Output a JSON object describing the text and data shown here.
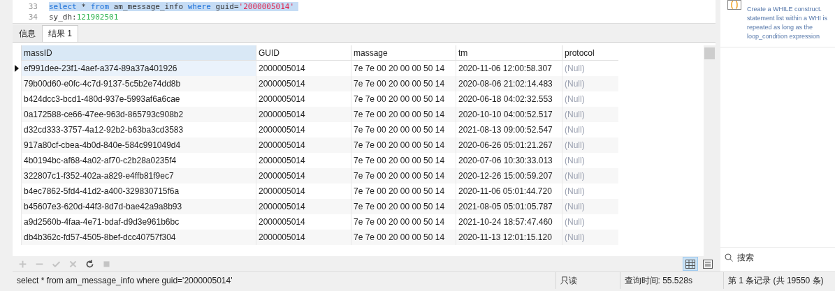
{
  "editor": {
    "lines": [
      {
        "number": "33",
        "highlighted": true,
        "tokens": [
          {
            "kind": "keyword",
            "text": "select"
          },
          {
            "kind": "plain",
            "text": " * "
          },
          {
            "kind": "keyword",
            "text": "from"
          },
          {
            "kind": "plain",
            "text": " am_message_info "
          },
          {
            "kind": "keyword",
            "text": "where"
          },
          {
            "kind": "plain",
            "text": " guid="
          },
          {
            "kind": "string",
            "text": "'2000005014'"
          }
        ]
      },
      {
        "number": "34",
        "highlighted": false,
        "tokens": [
          {
            "kind": "plain",
            "text": "sy_dh:"
          },
          {
            "kind": "number",
            "text": "121902501"
          }
        ]
      }
    ]
  },
  "help_panel": {
    "text": "Create a WHILE construct. statement list within a WHI is repeated as long as the loop_condition expression"
  },
  "tabs": [
    {
      "label": "信息",
      "selected": false
    },
    {
      "label": "结果 1",
      "selected": true
    }
  ],
  "table": {
    "columns": [
      "massID",
      "GUID",
      "massage",
      "tm",
      "protocol"
    ],
    "rows": [
      {
        "selected": true,
        "cells": [
          "ef991dee-23f1-4aef-a374-89a37a401926",
          "2000005014",
          "7e 7e 00 20 00 00 50 14",
          "2020-11-06 12:00:58.307",
          "(Null)"
        ]
      },
      {
        "selected": false,
        "cells": [
          "79b00d60-e0fc-4c7d-9137-5c5b2e74dd8b",
          "2000005014",
          "7e 7e 00 20 00 00 50 14",
          "2020-08-06 21:02:14.483",
          "(Null)"
        ]
      },
      {
        "selected": false,
        "cells": [
          "b424dcc3-bcd1-480d-937e-5993af6a6cae",
          "2000005014",
          "7e 7e 00 20 00 00 50 14",
          "2020-06-18 04:02:32.553",
          "(Null)"
        ]
      },
      {
        "selected": false,
        "cells": [
          "0a172588-ce66-47ee-963d-865793c908b2",
          "2000005014",
          "7e 7e 00 20 00 00 50 14",
          "2020-10-10 04:00:52.517",
          "(Null)"
        ]
      },
      {
        "selected": false,
        "cells": [
          "d32cd333-3757-4a12-92b2-b63ba3cd3583",
          "2000005014",
          "7e 7e 00 20 00 00 50 14",
          "2021-08-13 09:00:52.547",
          "(Null)"
        ]
      },
      {
        "selected": false,
        "cells": [
          "917a80cf-cbea-4b0d-840e-584c991049d4",
          "2000005014",
          "7e 7e 00 20 00 00 50 14",
          "2020-06-26 05:01:21.267",
          "(Null)"
        ]
      },
      {
        "selected": false,
        "cells": [
          "4b0194bc-af68-4a02-af70-c2b28a0235f4",
          "2000005014",
          "7e 7e 00 20 00 00 50 14",
          "2020-07-06 10:30:33.013",
          "(Null)"
        ]
      },
      {
        "selected": false,
        "cells": [
          "322807c1-f352-402a-a829-e4ffb81f9ec7",
          "2000005014",
          "7e 7e 00 20 00 00 50 14",
          "2020-12-26 15:00:59.207",
          "(Null)"
        ]
      },
      {
        "selected": false,
        "cells": [
          "b4ec7862-5fd4-41d2-a400-329830715f6a",
          "2000005014",
          "7e 7e 00 20 00 00 50 14",
          "2020-11-06 05:01:44.720",
          "(Null)"
        ]
      },
      {
        "selected": false,
        "cells": [
          "b45607e3-620d-44f3-8d7d-bae42a9a8b93",
          "2000005014",
          "7e 7e 00 20 00 00 50 14",
          "2021-08-05 05:01:05.787",
          "(Null)"
        ]
      },
      {
        "selected": false,
        "cells": [
          "a9d2560b-4faa-4e71-bdaf-d9d3e961b6bc",
          "2000005014",
          "7e 7e 00 20 00 00 50 14",
          "2021-10-24 18:57:47.460",
          "(Null)"
        ]
      },
      {
        "selected": false,
        "cells": [
          "db4b362c-fd57-4505-8bef-dcc40757f304",
          "2000005014",
          "7e 7e 00 20 00 00 50 14",
          "2020-11-13 12:01:15.120",
          "(Null)"
        ]
      }
    ]
  },
  "toolbar": [
    {
      "kind": "add",
      "disabled": true
    },
    {
      "kind": "remove",
      "disabled": true
    },
    {
      "kind": "apply",
      "disabled": true
    },
    {
      "kind": "cancel",
      "disabled": true
    },
    {
      "kind": "refresh",
      "disabled": false
    },
    {
      "kind": "stop",
      "disabled": true
    }
  ],
  "view_toggle": [
    {
      "kind": "grid",
      "selected": true
    },
    {
      "kind": "form",
      "selected": false
    }
  ],
  "search": {
    "placeholder": "搜索"
  },
  "status_bar": {
    "sql": "select * from am_message_info where guid='2000005014'",
    "mode": "只读",
    "query_time": "查询时间: 55.528s",
    "record": "第 1 条记录 (共 19550 条)"
  }
}
